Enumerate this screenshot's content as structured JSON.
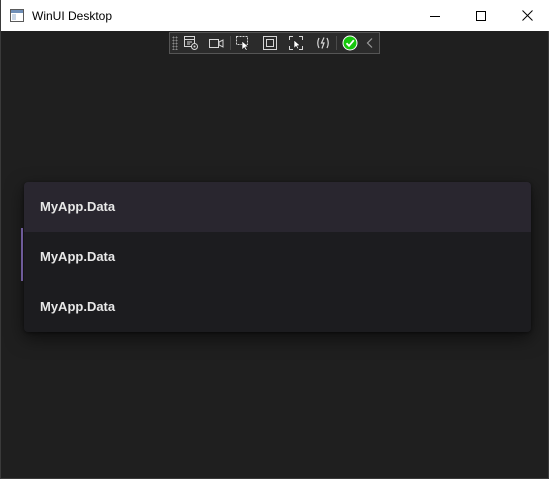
{
  "window": {
    "title": "WinUI Desktop"
  },
  "titlebar": {
    "icons": [
      "app-window-icon",
      "minimize-icon",
      "maximize-icon",
      "close-icon"
    ]
  },
  "debug_toolbar": {
    "icons": [
      "toolbar-grip-icon",
      "live-visual-tree-icon",
      "record-icon",
      "select-element-icon",
      "display-layout-adorners-icon",
      "track-focus-icon",
      "hot-reload-icon",
      "status-ok-icon",
      "collapse-chevron-icon"
    ]
  },
  "list": {
    "items": [
      {
        "label": "MyApp.Data",
        "state": "hover"
      },
      {
        "label": "MyApp.Data",
        "state": "focused"
      },
      {
        "label": "MyApp.Data",
        "state": "normal"
      }
    ]
  },
  "colors": {
    "background": "#1f1f1f",
    "titlebar": "#ffffff",
    "panel": "#1c1c1f",
    "item_hover": "#29262f",
    "accent_focus": "#6e5b9a",
    "status_ok": "#16c60c"
  }
}
